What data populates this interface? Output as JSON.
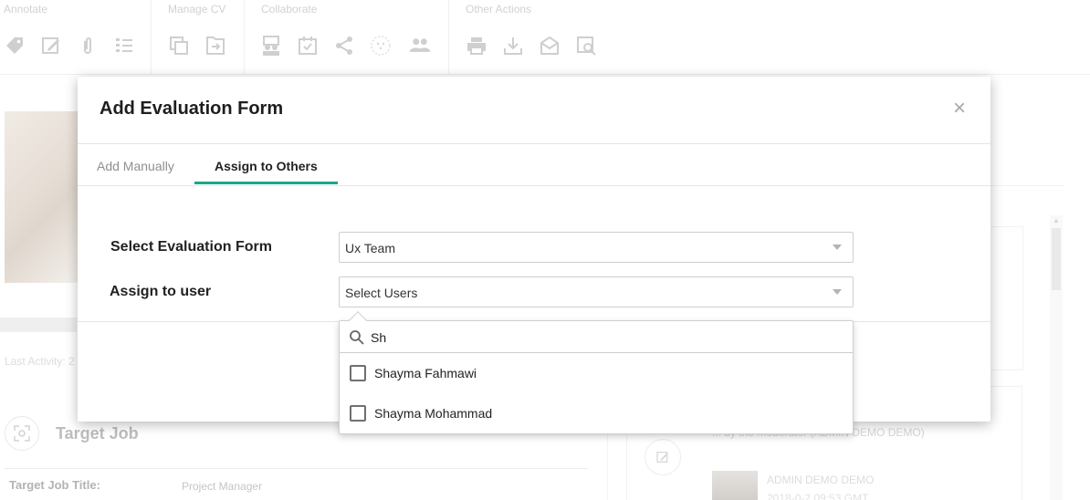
{
  "toolbar": {
    "groups": [
      {
        "label": "Annotate",
        "icons": [
          "tag-icon",
          "edit-icon",
          "paperclip-icon",
          "checklist-icon"
        ]
      },
      {
        "label": "Manage CV",
        "icons": [
          "copy-icon",
          "move-icon"
        ]
      },
      {
        "label": "Collaborate",
        "icons": [
          "presenter-icon",
          "calendar-check-icon",
          "share-icon",
          "face-icon",
          "users-sync-icon"
        ]
      },
      {
        "label": "Other Actions",
        "icons": [
          "print-icon",
          "download-icon",
          "email-icon",
          "preview-icon"
        ]
      }
    ]
  },
  "background": {
    "last_activity": "Last Activity: 2",
    "target_job_heading": "Target Job",
    "target_job_title_label": "Target Job Title:",
    "target_job_title_value": "Project Manager",
    "activity_text": "...                by the moderator (ADMIN DEMO DEMO)",
    "activity_user": "ADMIN DEMO DEMO",
    "activity_date": "2018-0-2 09:53 GMT"
  },
  "modal": {
    "title": "Add Evaluation Form",
    "close_symbol": "×",
    "tabs": [
      {
        "label": "Add Manually",
        "active": false
      },
      {
        "label": "Assign to Others",
        "active": true
      }
    ],
    "select_form_label": "Select Evaluation Form",
    "select_form_value": "Ux Team",
    "assign_user_label": "Assign to user",
    "assign_user_placeholder": "Select Users"
  },
  "dropdown": {
    "search_value": "Sh",
    "options": [
      {
        "label": "Shayma Fahmawi",
        "checked": false
      },
      {
        "label": "Shayma Mohammad",
        "checked": false
      }
    ]
  },
  "colors": {
    "accent": "#1aa78a",
    "icon_gray": "#b5b5b5",
    "title_text": "#1e1e1e"
  }
}
